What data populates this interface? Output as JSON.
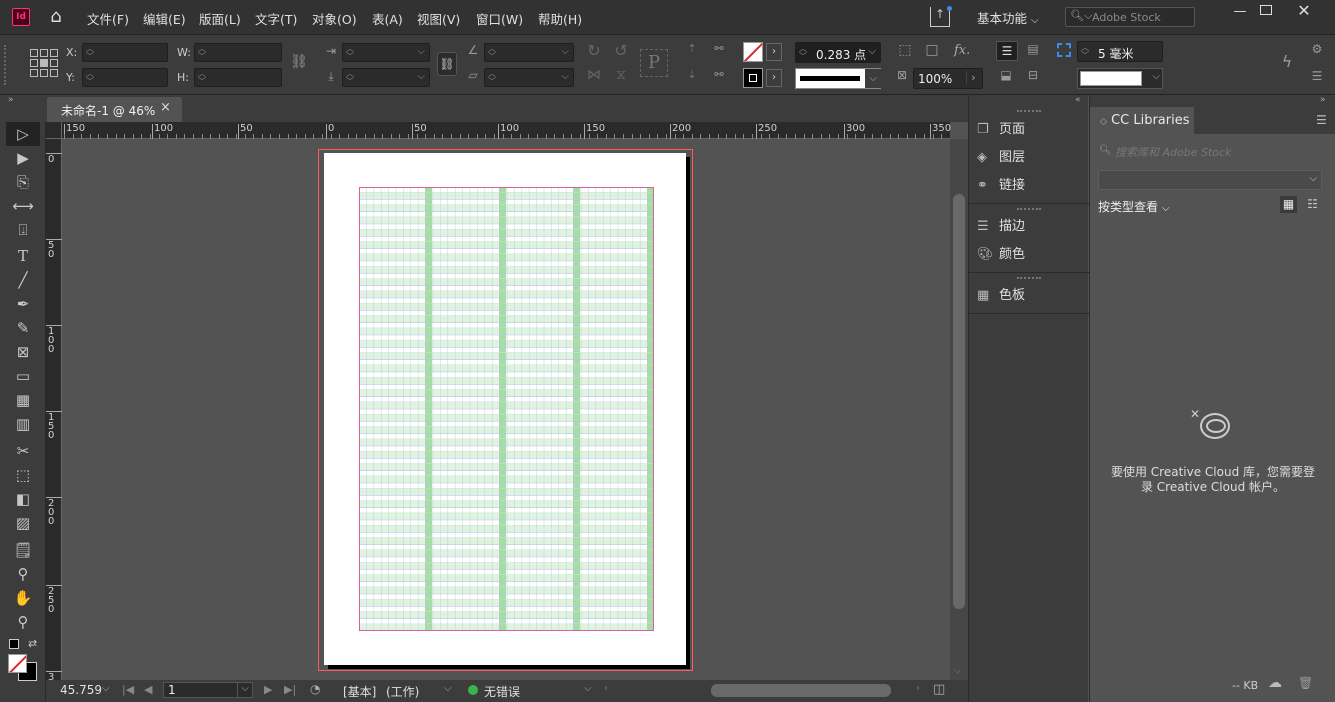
{
  "app": {
    "logo": "Id"
  },
  "menu": [
    "文件(F)",
    "编辑(E)",
    "版面(L)",
    "文字(T)",
    "对象(O)",
    "表(A)",
    "视图(V)",
    "窗口(W)",
    "帮助(H)"
  ],
  "workspace": {
    "label": "基本功能",
    "stock_placeholder": "Adobe Stock"
  },
  "control": {
    "x_label": "X:",
    "y_label": "Y:",
    "w_label": "W:",
    "h_label": "H:",
    "stroke_weight": "0.283 点",
    "opacity": "100%",
    "gutter": "5 毫米",
    "fx_label": "fx."
  },
  "document": {
    "tab_title": "未命名-1 @ 46%",
    "close": "×"
  },
  "ruler": {
    "h_ticks": [
      "150",
      "100",
      "50",
      "0",
      "50",
      "100",
      "150",
      "200",
      "250",
      "300",
      "350"
    ],
    "v_ticks": [
      "0",
      "5\n0",
      "1\n0\n0",
      "1\n5\n0",
      "2\n0\n0",
      "2\n5\n0",
      "3"
    ]
  },
  "status": {
    "zoom": "45.759",
    "page": "1",
    "style": "[基本]",
    "mode": "(工作)",
    "preflight": "无错误"
  },
  "panels": {
    "group1": [
      "页面",
      "图层",
      "链接"
    ],
    "group2": [
      "描边",
      "颜色"
    ],
    "group3": [
      "色板"
    ]
  },
  "cc": {
    "tab": "CC Libraries",
    "search_placeholder": "搜索库和 Adobe Stock",
    "view_by": "按类型查看",
    "message_line1": "要使用 Creative Cloud 库，您需要登",
    "message_line2": "录 Creative Cloud 帐户。",
    "size": "-- KB"
  },
  "colors": {
    "grid_green": "#a6dca6",
    "grid_line": "#b7c7e3",
    "margin": "#d7629a",
    "page_border": "#ff5a5a",
    "accent": "#ff3366"
  }
}
